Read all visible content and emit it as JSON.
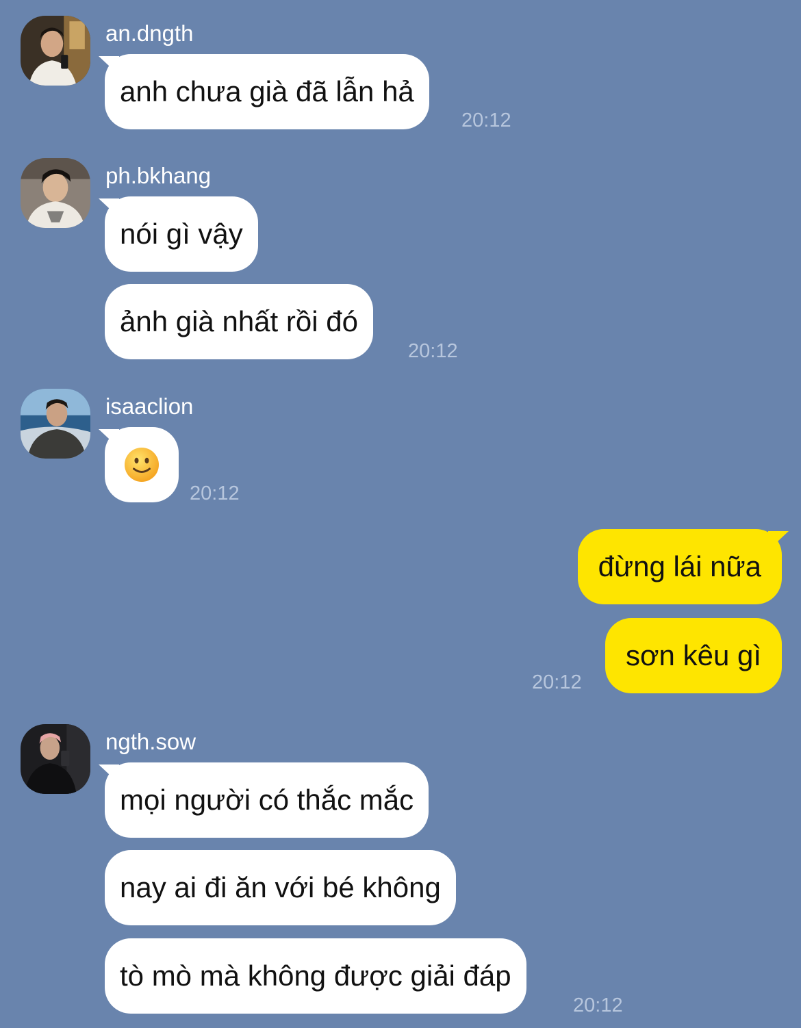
{
  "messages": [
    {
      "sender": "an.dngth",
      "bubbles": [
        "anh chưa già đã lẫn hả"
      ],
      "time": "20:12"
    },
    {
      "sender": "ph.bkhang",
      "bubbles": [
        "nói gì vậy",
        "ảnh già nhất rồi đó"
      ],
      "time": "20:12"
    },
    {
      "sender": "isaaclion",
      "emoji": "slightly-smiling-face",
      "time": "20:12"
    },
    {
      "sender": "me",
      "bubbles": [
        "đừng lái nữa",
        "sơn kêu gì"
      ],
      "time": "20:12"
    },
    {
      "sender": "ngth.sow",
      "bubbles": [
        "mọi người có thắc mắc",
        "nay ai đi ăn với bé không",
        "tò mò mà không được giải đáp"
      ],
      "time": "20:12"
    }
  ],
  "colors": {
    "background": "#6984ad",
    "incoming_bubble": "#ffffff",
    "outgoing_bubble": "#fee500",
    "timestamp": "#b7c6dd"
  }
}
